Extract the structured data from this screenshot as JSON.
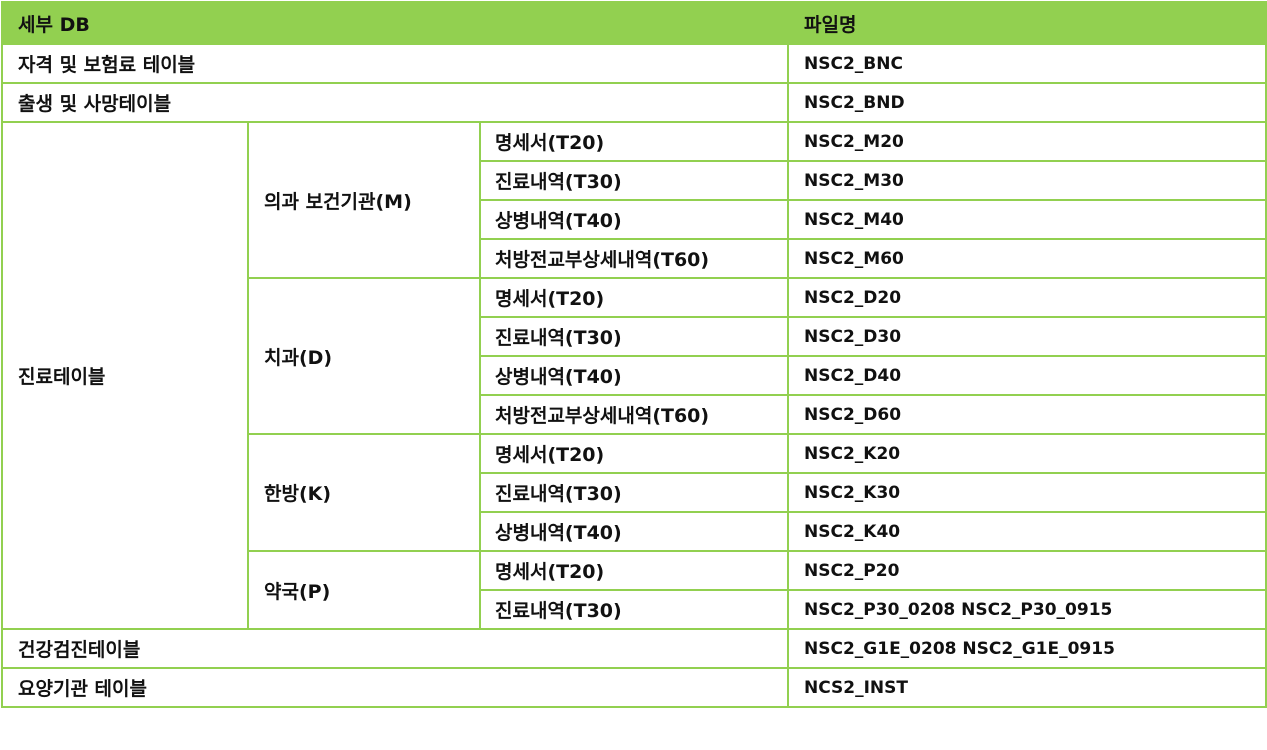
{
  "header": {
    "db": "세부 DB",
    "file": "파일명"
  },
  "rows": {
    "qualification": {
      "label": "자격 및 보험료 테이블",
      "file": "NSC2_BNC"
    },
    "birth_death": {
      "label": "출생 및 사망테이블",
      "file": "NSC2_BND"
    },
    "treatment": {
      "label": "진료테이블",
      "medical": {
        "label": "의과 보건기관(M)",
        "items": [
          {
            "label": "명세서(T20)",
            "file": "NSC2_M20"
          },
          {
            "label": "진료내역(T30)",
            "file": "NSC2_M30"
          },
          {
            "label": "상병내역(T40)",
            "file": "NSC2_M40"
          },
          {
            "label": "처방전교부상세내역(T60)",
            "file": "NSC2_M60"
          }
        ]
      },
      "dental": {
        "label": "치과(D)",
        "items": [
          {
            "label": "명세서(T20)",
            "file": "NSC2_D20"
          },
          {
            "label": "진료내역(T30)",
            "file": "NSC2_D30"
          },
          {
            "label": "상병내역(T40)",
            "file": "NSC2_D40"
          },
          {
            "label": "처방전교부상세내역(T60)",
            "file": "NSC2_D60"
          }
        ]
      },
      "oriental": {
        "label": "한방(K)",
        "items": [
          {
            "label": "명세서(T20)",
            "file": "NSC2_K20"
          },
          {
            "label": "진료내역(T30)",
            "file": "NSC2_K30"
          },
          {
            "label": "상병내역(T40)",
            "file": "NSC2_K40"
          }
        ]
      },
      "pharmacy": {
        "label": "약국(P)",
        "items": [
          {
            "label": "명세서(T20)",
            "file": "NSC2_P20"
          },
          {
            "label": "진료내역(T30)",
            "file": "NSC2_P30_0208 NSC2_P30_0915"
          }
        ]
      }
    },
    "health_checkup": {
      "label": "건강검진테이블",
      "file": "NSC2_G1E_0208 NSC2_G1E_0915"
    },
    "care_institution": {
      "label": "요양기관 테이블",
      "file": "NCS2_INST"
    }
  }
}
